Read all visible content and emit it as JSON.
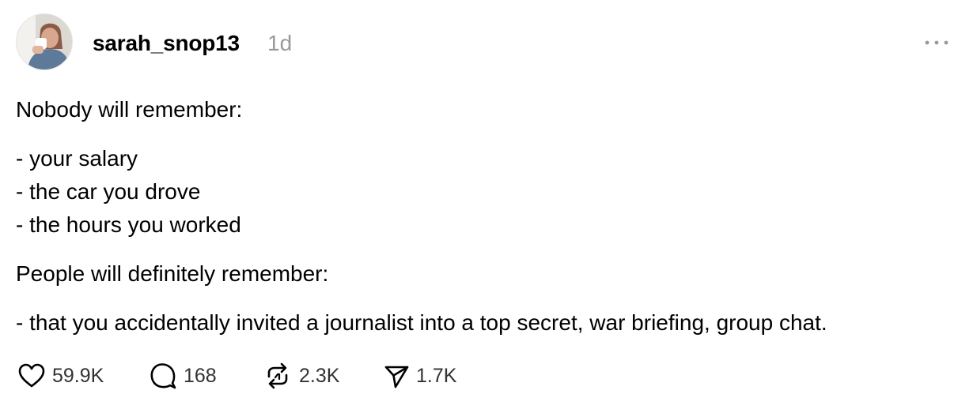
{
  "post": {
    "username": "sarah_snop13",
    "timestamp": "1d",
    "paragraphs": {
      "intro": "Nobody will remember:",
      "list1": [
        "- your salary",
        "- the car you drove",
        "- the hours you worked"
      ],
      "intro2": "People will definitely remember:",
      "list2": [
        "- that you accidentally invited a journalist into a top secret, war briefing, group chat."
      ]
    }
  },
  "actions": {
    "likes": "59.9K",
    "replies": "168",
    "reposts": "2.3K",
    "shares": "1.7K"
  },
  "icons": {
    "like": "heart-icon",
    "reply": "speech-bubble-icon",
    "repost": "repost-arrows-icon",
    "share": "paper-plane-icon",
    "more": "ellipsis-icon"
  },
  "colors": {
    "text": "#000000",
    "muted": "#999999",
    "count": "#333333"
  }
}
